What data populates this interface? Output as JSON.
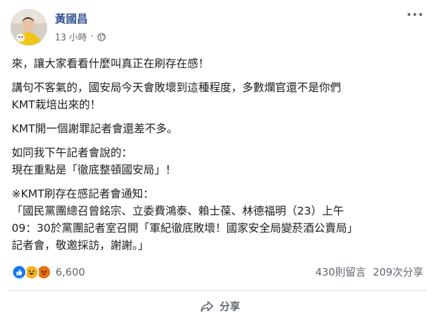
{
  "post": {
    "author": "黃國昌",
    "time": "13 小時",
    "dot": "·",
    "more": "···",
    "paragraphs": [
      "來，讓大家看看什麼叫真正在刷存在感！",
      "講句不客氣的，國安局今天會敗壞到這種程度，多數爛官還不是你們\nKMT栽培出來的！",
      "KMT開一個謝罪記者會還差不多。",
      "如同我下午記者會說的：\n現在重點是「徹底整頓國安局」！",
      "※KMT刷存在感記者會通知：\n「國民黨團總召曾銘宗、立委費鴻泰、賴士葆、林德福明（23）上午\n09：30於黨團記者室召開「軍紀徹底敗壞！國家安全局變菸酒公賣局」\n記者會，敬邀採訪，謝謝。」"
    ],
    "reactions": {
      "count": "6,600",
      "types": [
        "like-icon",
        "haha-icon",
        "angry-icon"
      ]
    },
    "comments": "430則留言",
    "shares": "209次分享",
    "share_label": "分享"
  },
  "colors": {
    "author": "#385898",
    "like": "#1877f2",
    "haha": "#f7b125",
    "angry": "#e9710f"
  }
}
